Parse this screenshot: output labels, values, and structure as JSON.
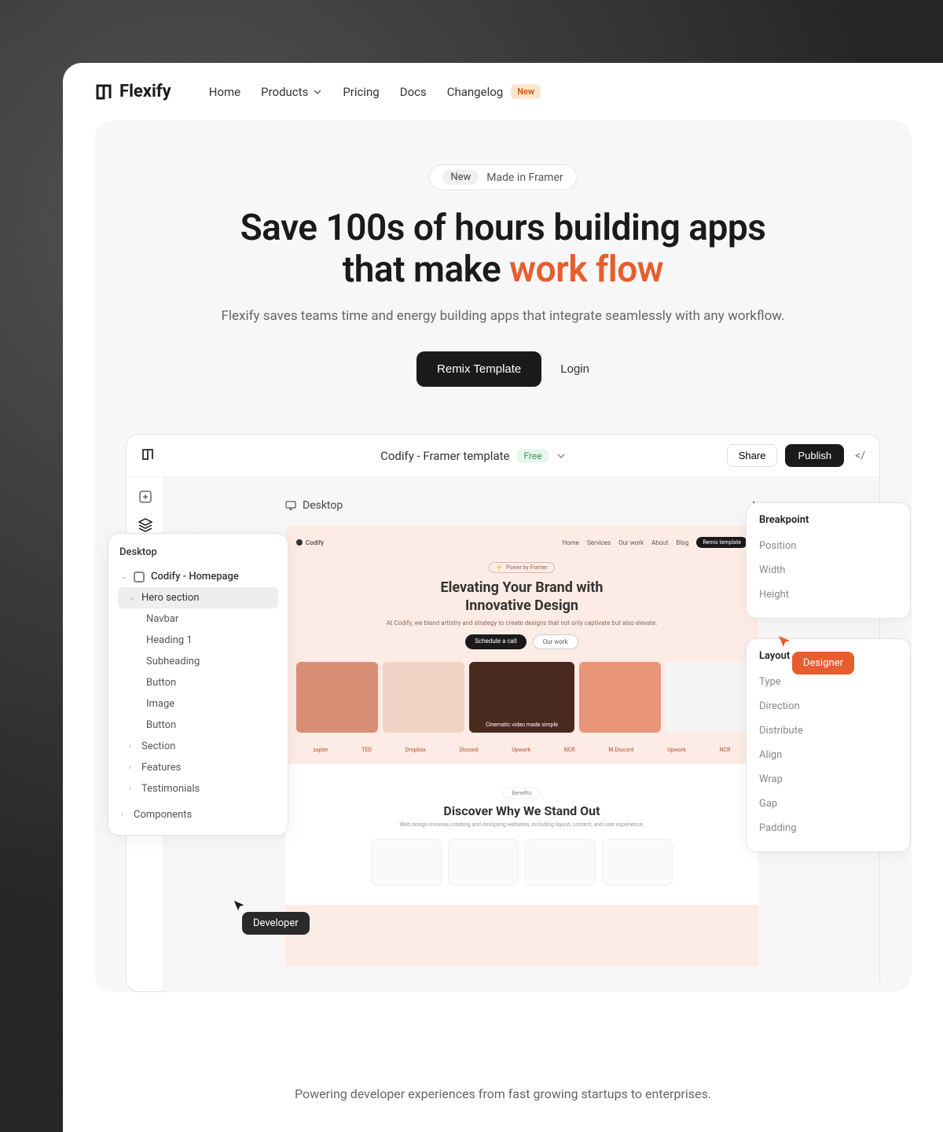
{
  "brand": "Flexify",
  "nav": {
    "home": "Home",
    "products": "Products",
    "pricing": "Pricing",
    "docs": "Docs",
    "changelog": "Changelog",
    "new_badge": "New"
  },
  "hero": {
    "pill_tag": "New",
    "pill_text": "Made in Framer",
    "title_a": "Save 100s of hours building apps",
    "title_b": "that make ",
    "title_accent": "work flow",
    "subhead": "Flexify saves teams time and energy building apps that integrate seamlessly with any workflow.",
    "cta_primary": "Remix Template",
    "cta_secondary": "Login"
  },
  "editor": {
    "title": "Codify - Framer template",
    "tag": "Free",
    "share": "Share",
    "publish": "Publish",
    "canvas_label": "Desktop"
  },
  "layers": {
    "head": "Desktop",
    "root": "Codify - Homepage",
    "items": [
      "Hero section",
      "Navbar",
      "Heading 1",
      "Subheading",
      "Button",
      "Image",
      "Button",
      "Section",
      "Features",
      "Testimonials"
    ],
    "components": "Components"
  },
  "preview": {
    "brand": "Codify",
    "nav": [
      "Home",
      "Services",
      "Our work",
      "About",
      "Blog"
    ],
    "nav_btn": "Remix template",
    "pill": "Power by Framer",
    "title1": "Elevating Your Brand with",
    "title2": "Innovative Design",
    "sub": "At Codify, we blend artistry and strategy to create designs that not only captivate but also elevate.",
    "cta1": "Schedule a call",
    "cta2": "Our work",
    "cardline": "Cinematic video made simple",
    "trusted": [
      "zapier",
      "TED",
      "Dropbox",
      "Discord",
      "Upwork",
      "NCR",
      "M.Discord",
      "Upwork",
      "NCR"
    ],
    "s2_pill": "Benefits",
    "s2_title": "Discover Why We Stand Out",
    "s2_sub": "Web design involves creating and designing websites, including layout, content, and user experience."
  },
  "cursors": {
    "developer": "Developer",
    "designer": "Designer"
  },
  "props1": {
    "head": "Breakpoint",
    "rows": [
      "Position",
      "Width",
      "Height"
    ]
  },
  "props2": {
    "head": "Layout",
    "rows": [
      "Type",
      "Direction",
      "Distribute",
      "Align",
      "Wrap",
      "Gap",
      "Padding"
    ]
  },
  "footer": "Powering developer experiences from fast growing startups to enterprises."
}
